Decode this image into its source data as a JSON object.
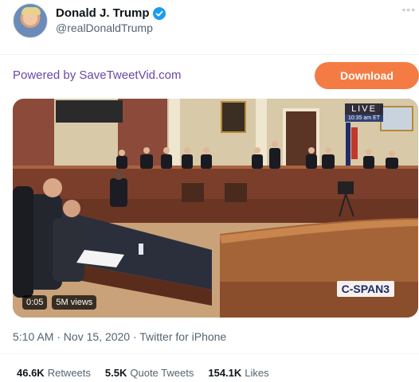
{
  "author": {
    "display_name": "Donald J. Trump",
    "handle": "@realDonaldTrump",
    "avatar_icon": "profile-photo",
    "verified_icon": "verified-badge-icon",
    "verified_color": "#1d9bf0"
  },
  "header": {
    "more_icon": "°°°"
  },
  "promo": {
    "powered_text": "Powered by SaveTweetVid.com",
    "download_label": "Download",
    "download_color": "#f47c44"
  },
  "video": {
    "live_label": "LIVE",
    "live_time": "10:35 am ET",
    "network_logo": "C-SPAN3",
    "duration": "0:05",
    "views": "5M views"
  },
  "tweet": {
    "timestamp": "5:10 AM · Nov 15, 2020 · Twitter for iPhone"
  },
  "stats": {
    "retweets_count": "46.6K",
    "retweets_label": "Retweets",
    "quotes_count": "5.5K",
    "quotes_label": "Quote Tweets",
    "likes_count": "154.1K",
    "likes_label": "Likes"
  }
}
